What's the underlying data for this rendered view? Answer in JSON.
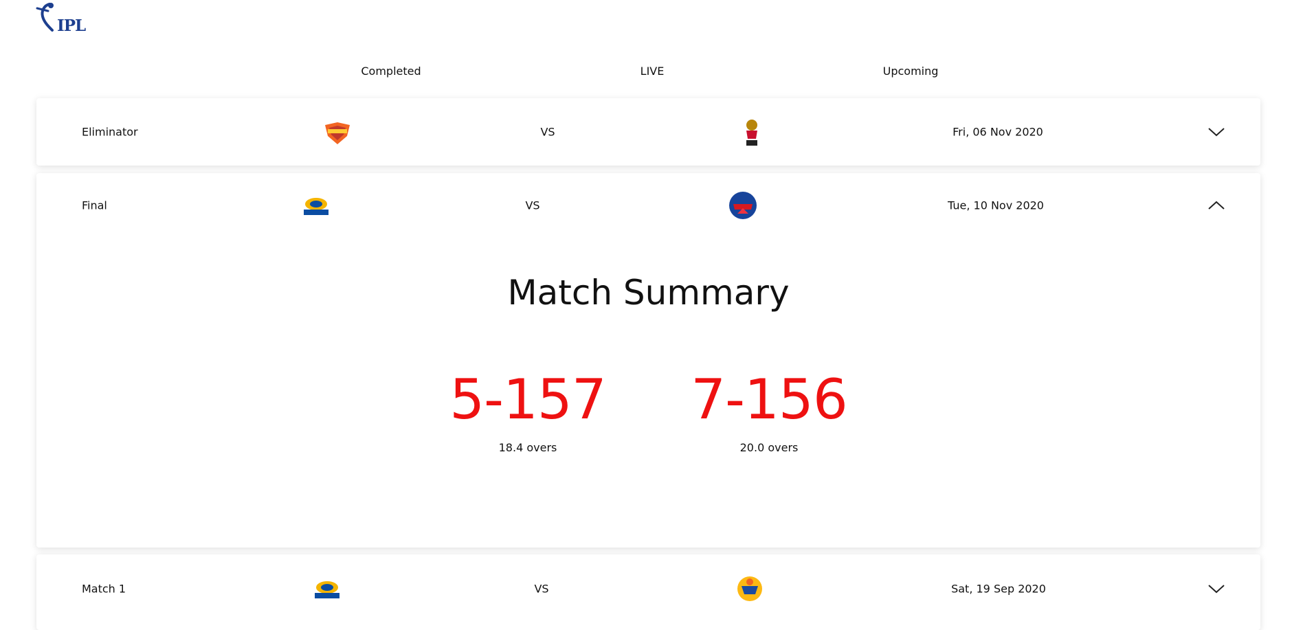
{
  "brand": {
    "logo_text": "IPL"
  },
  "tabs": [
    {
      "label": "Completed"
    },
    {
      "label": "LIVE"
    },
    {
      "label": "Upcoming"
    }
  ],
  "matches": [
    {
      "stage": "Eliminator",
      "team1": "sunrisers-hyderabad-logo",
      "vs": "VS",
      "team2": "royal-challengers-bangalore-logo",
      "date": "Fri, 06 Nov 2020",
      "expanded": false
    },
    {
      "stage": "Final",
      "team1": "mumbai-indians-logo",
      "vs": "VS",
      "team2": "delhi-capitals-logo",
      "date": "Tue, 10 Nov 2020",
      "expanded": true
    },
    {
      "stage": "Match 1",
      "team1": "mumbai-indians-logo",
      "vs": "VS",
      "team2": "chennai-super-kings-logo",
      "date": "Sat, 19 Sep 2020",
      "expanded": false
    }
  ],
  "summary": {
    "title": "Match Summary",
    "innings": [
      {
        "score": "5-157",
        "overs": "18.4 overs"
      },
      {
        "score": "7-156",
        "overs": "20.0 overs"
      }
    ]
  },
  "colors": {
    "score": "#ee1111",
    "ipl_blue": "#1d3f8f",
    "page_bg": "#ffffff"
  },
  "icons": {
    "expand": "chevron-down-icon",
    "collapse": "chevron-up-icon"
  }
}
